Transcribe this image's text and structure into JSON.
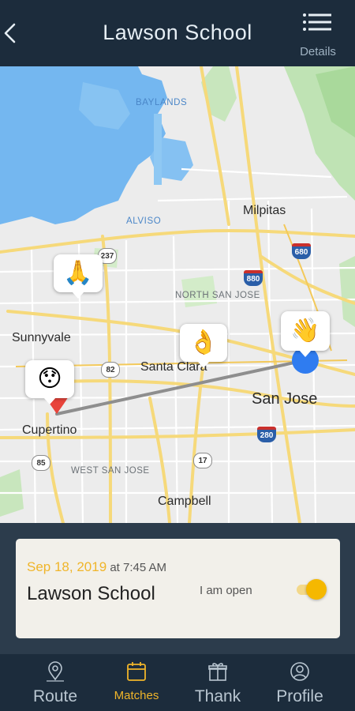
{
  "header": {
    "title": "Lawson School",
    "details_label": "Details"
  },
  "map": {
    "places": {
      "baylands": "BAYLANDS",
      "alviso": "ALVISO",
      "milpitas": "Milpitas",
      "north_san_jose": "NORTH SAN JOSE",
      "sunnyvale": "Sunnyvale",
      "santa_clara": "Santa Clara",
      "san_jose": "San Jose",
      "cupertino": "Cupertino",
      "west_san_jose": "WEST SAN JOSE",
      "campbell": "Campbell"
    },
    "shields": {
      "s237": "237",
      "s680": "680",
      "s880": "880",
      "s82": "82",
      "s280": "280",
      "s85": "85",
      "s17": "17"
    },
    "emoji": {
      "pray": "🙏",
      "ok": "👌",
      "wave": "👋",
      "face": "😯"
    }
  },
  "card": {
    "date": "Sep 18, 2019",
    "at_time": " at 7:45 AM",
    "name": "Lawson School",
    "status": "I am open",
    "toggle_on": true
  },
  "tabs": [
    {
      "label": "Route",
      "icon": "map-pin-icon",
      "active": false
    },
    {
      "label": "Matches",
      "icon": "calendar-icon",
      "active": true
    },
    {
      "label": "Thank",
      "icon": "gift-icon",
      "active": false
    },
    {
      "label": "Profile",
      "icon": "user-icon",
      "active": false
    }
  ],
  "colors": {
    "header_bg": "#1c2c3c",
    "accent": "#f0b52a",
    "water": "#74b7f0",
    "park": "#bfe3b4",
    "road": "#f6d97a",
    "origin_pin": "#e8443b",
    "destination_dot": "#2f7cf0"
  }
}
